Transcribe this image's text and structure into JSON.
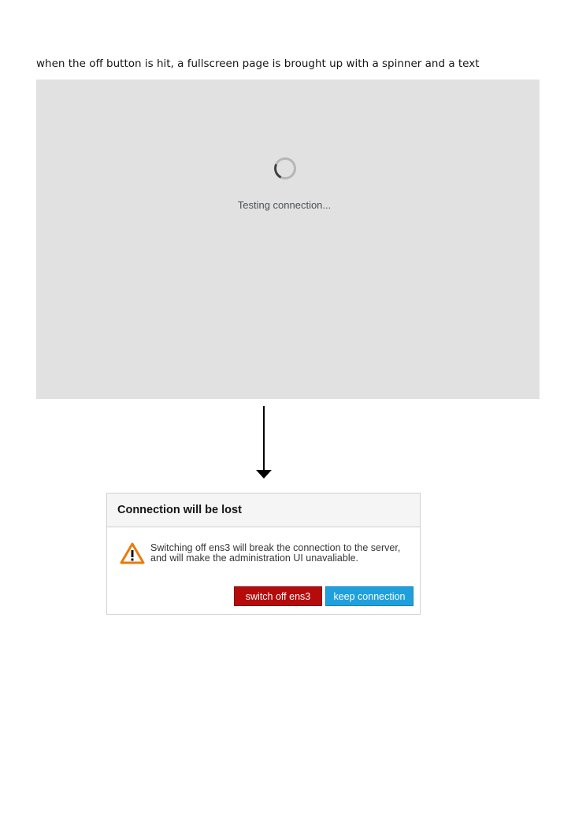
{
  "caption": "when the off button is hit, a fullscreen page is brought up with a spinner and a text",
  "overlay": {
    "loading_text": "Testing connection..."
  },
  "dialog": {
    "title": "Connection will be lost",
    "message_line1": "Switching off ens3 will break the connection to the server,",
    "message_line2": "and will make the administration UI unavaliable.",
    "icon": "warning-icon",
    "buttons": {
      "switch_off": "switch off ens3",
      "keep": "keep connection"
    }
  },
  "colors": {
    "overlay_bg": "#e1e1e1",
    "danger": "#b50b0b",
    "primary": "#1fa0dd",
    "warning": "#ec7a08"
  }
}
